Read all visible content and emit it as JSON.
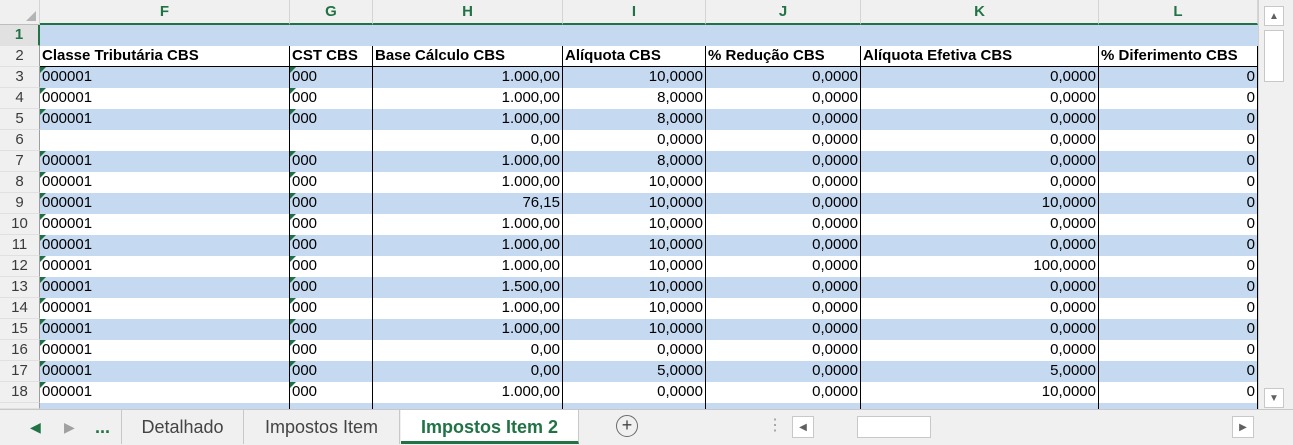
{
  "columns": [
    "F",
    "G",
    "H",
    "I",
    "J",
    "K",
    "L"
  ],
  "row_numbers": [
    "1",
    "2",
    "3",
    "4",
    "5",
    "6",
    "7",
    "8",
    "9",
    "10",
    "11",
    "12",
    "13",
    "14",
    "15",
    "16",
    "17",
    "18"
  ],
  "headers": [
    "Classe Tributária CBS",
    "CST CBS",
    "Base Cálculo CBS",
    "Alíquota CBS",
    "% Redução CBS",
    "Alíquota Efetiva CBS",
    "% Diferimento CBS"
  ],
  "rows": [
    [
      "000001",
      "000",
      "1.000,00",
      "10,0000",
      "0,0000",
      "0,0000",
      "0"
    ],
    [
      "000001",
      "000",
      "1.000,00",
      "8,0000",
      "0,0000",
      "0,0000",
      "0"
    ],
    [
      "000001",
      "000",
      "1.000,00",
      "8,0000",
      "0,0000",
      "0,0000",
      "0"
    ],
    [
      "",
      "",
      "0,00",
      "0,0000",
      "0,0000",
      "0,0000",
      "0"
    ],
    [
      "000001",
      "000",
      "1.000,00",
      "8,0000",
      "0,0000",
      "0,0000",
      "0"
    ],
    [
      "000001",
      "000",
      "1.000,00",
      "10,0000",
      "0,0000",
      "0,0000",
      "0"
    ],
    [
      "000001",
      "000",
      "76,15",
      "10,0000",
      "0,0000",
      "10,0000",
      "0"
    ],
    [
      "000001",
      "000",
      "1.000,00",
      "10,0000",
      "0,0000",
      "0,0000",
      "0"
    ],
    [
      "000001",
      "000",
      "1.000,00",
      "10,0000",
      "0,0000",
      "0,0000",
      "0"
    ],
    [
      "000001",
      "000",
      "1.000,00",
      "10,0000",
      "0,0000",
      "100,0000",
      "0"
    ],
    [
      "000001",
      "000",
      "1.500,00",
      "10,0000",
      "0,0000",
      "0,0000",
      "0"
    ],
    [
      "000001",
      "000",
      "1.000,00",
      "10,0000",
      "0,0000",
      "0,0000",
      "0"
    ],
    [
      "000001",
      "000",
      "1.000,00",
      "10,0000",
      "0,0000",
      "0,0000",
      "0"
    ],
    [
      "000001",
      "000",
      "0,00",
      "0,0000",
      "0,0000",
      "0,0000",
      "0"
    ],
    [
      "000001",
      "000",
      "0,00",
      "5,0000",
      "0,0000",
      "5,0000",
      "0"
    ],
    [
      "000001",
      "000",
      "1.000,00",
      "0,0000",
      "0,0000",
      "10,0000",
      "0"
    ]
  ],
  "tabs": {
    "ellipsis": "...",
    "sheets": [
      "Detalhado",
      "Impostos Item",
      "Impostos Item 2"
    ],
    "active_sheet": "Impostos Item 2",
    "add_icon": "plus-circle-icon"
  },
  "colors": {
    "band": "#c5d9f1",
    "accent": "#217346",
    "warning_triangle": "#1e7145"
  }
}
